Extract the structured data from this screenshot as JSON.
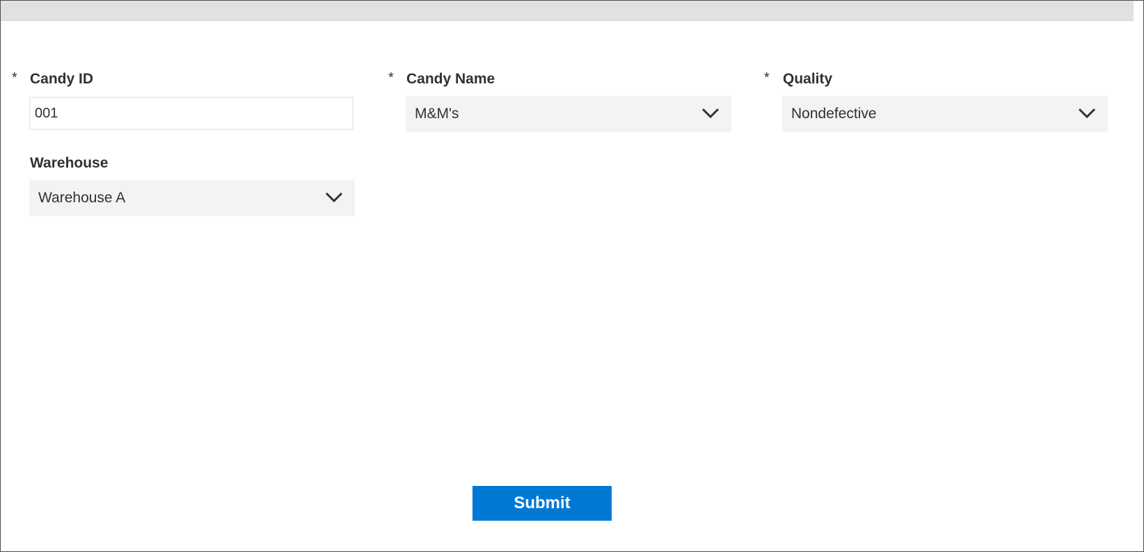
{
  "form": {
    "candy_id": {
      "required_marker": "*",
      "label": "Candy ID",
      "value": "001"
    },
    "candy_name": {
      "required_marker": "*",
      "label": "Candy Name",
      "value": "M&M's",
      "icon": "chevron-down-icon"
    },
    "quality": {
      "required_marker": "*",
      "label": "Quality",
      "value": "Nondefective",
      "icon": "chevron-down-icon"
    },
    "warehouse": {
      "label": "Warehouse",
      "value": "Warehouse A",
      "icon": "chevron-down-icon"
    }
  },
  "actions": {
    "submit_label": "Submit"
  },
  "colors": {
    "accent": "#0078d4",
    "dropdown_bg": "#f3f3f3",
    "topbar_bg": "#e1e1e1",
    "text": "#323130"
  }
}
